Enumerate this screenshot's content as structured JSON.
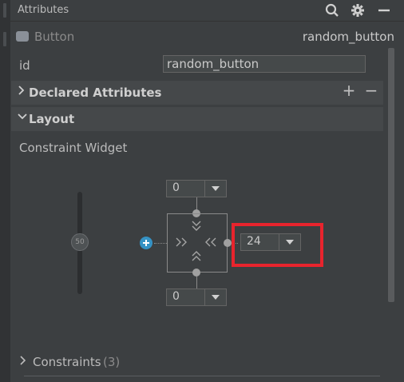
{
  "window": {
    "title": "Attributes"
  },
  "toolbar": {
    "icons": [
      "search-icon",
      "gear-icon",
      "minimize-icon"
    ]
  },
  "component": {
    "icon": "button-widget-icon",
    "type": "Button",
    "id": "random_button"
  },
  "attributes": {
    "id_label": "id",
    "id_value": "random_button"
  },
  "sections": {
    "declared": {
      "label": "Declared Attributes",
      "add": "+",
      "remove": "−",
      "expanded": false
    },
    "layout": {
      "label": "Layout",
      "expanded": true
    }
  },
  "layout": {
    "widget_label": "Constraint Widget",
    "vertical_bias": "50",
    "margins": {
      "top": "0",
      "bottom": "0",
      "end": "24"
    },
    "glyphs": {
      "down": "⌄⌄",
      "up": "⌃⌃",
      "right": "»",
      "left": "«"
    }
  },
  "constraints": {
    "label": "Constraints",
    "count": "(3)"
  },
  "colors": {
    "background": "#3c3f41",
    "highlight": "#e8242d",
    "accent": "#3592c4"
  }
}
